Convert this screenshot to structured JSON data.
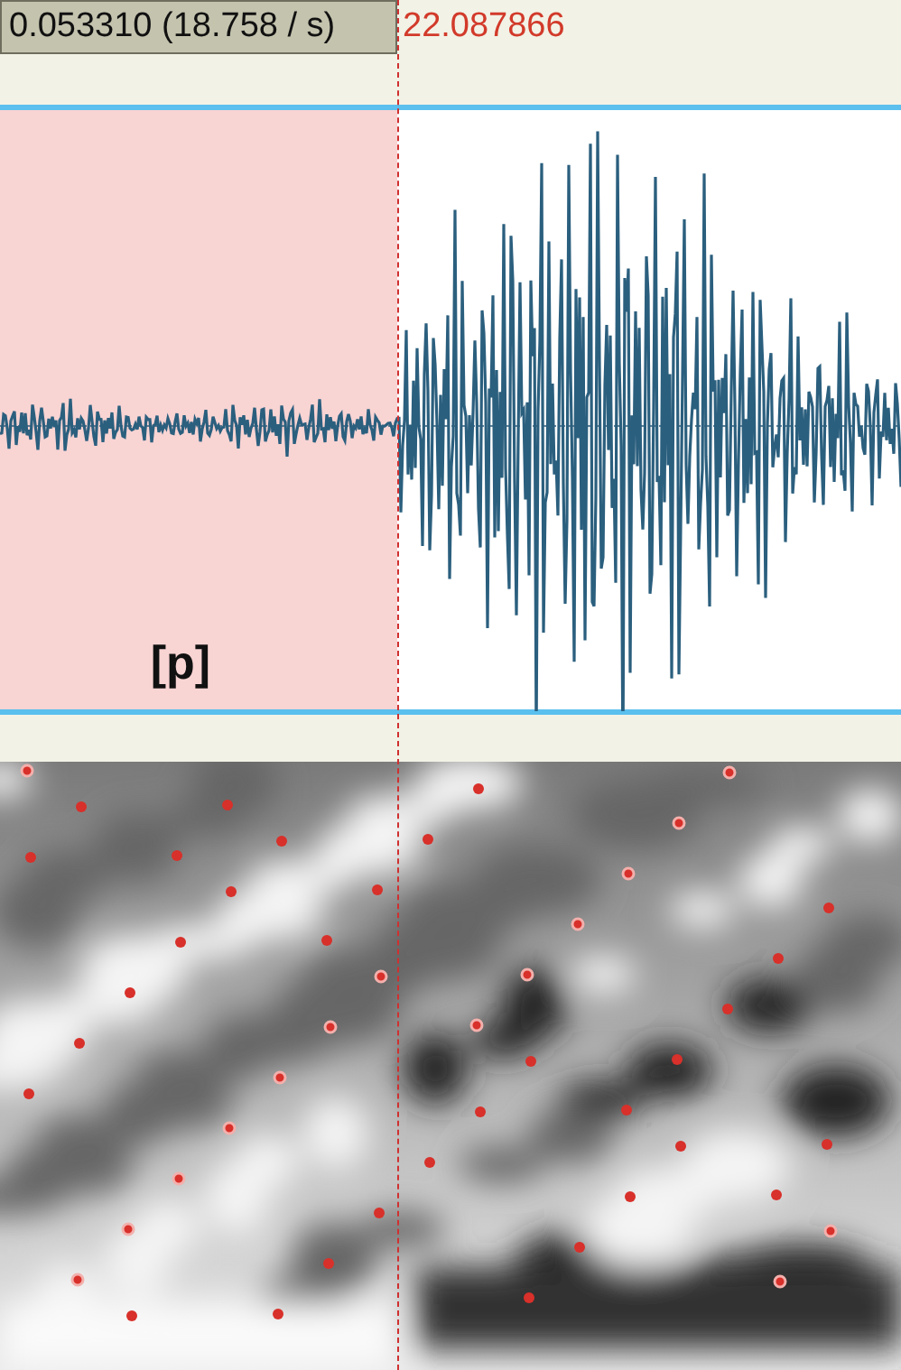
{
  "selection": {
    "duration": "0.053310 (18.758 / s)"
  },
  "cursor": {
    "time": "22.087866"
  },
  "waveform": {
    "label": "[p]"
  }
}
